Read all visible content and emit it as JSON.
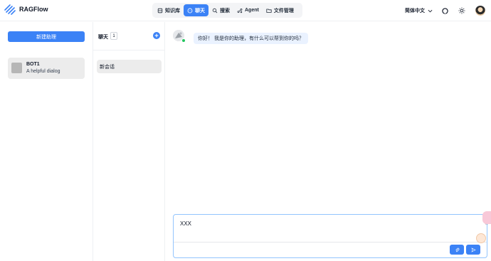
{
  "app": {
    "name": "RAGFlow"
  },
  "nav": {
    "items": [
      {
        "label": "知识库",
        "icon": "database-icon",
        "active": false
      },
      {
        "label": "聊天",
        "icon": "chat-icon",
        "active": true
      },
      {
        "label": "搜索",
        "icon": "search-icon",
        "active": false
      },
      {
        "label": "Agent",
        "icon": "agent-icon",
        "active": false
      },
      {
        "label": "文件管理",
        "icon": "folder-icon",
        "active": false
      }
    ]
  },
  "header": {
    "language": "简体中文"
  },
  "assistants": {
    "new_button": "新建助理",
    "list": [
      {
        "name": "BOT1",
        "description": "A helpful dialog"
      }
    ]
  },
  "conversations": {
    "title": "聊天",
    "count": "1",
    "items": [
      {
        "label": "新会话"
      }
    ]
  },
  "chat": {
    "messages": [
      {
        "role": "assistant",
        "text": "你好！ 我是你的助理，有什么可以帮到你的吗？"
      }
    ],
    "input_value": "XXX"
  },
  "colors": {
    "accent": "#3b82f6",
    "online": "#22c55e",
    "bubble": "#eaf2ff"
  }
}
